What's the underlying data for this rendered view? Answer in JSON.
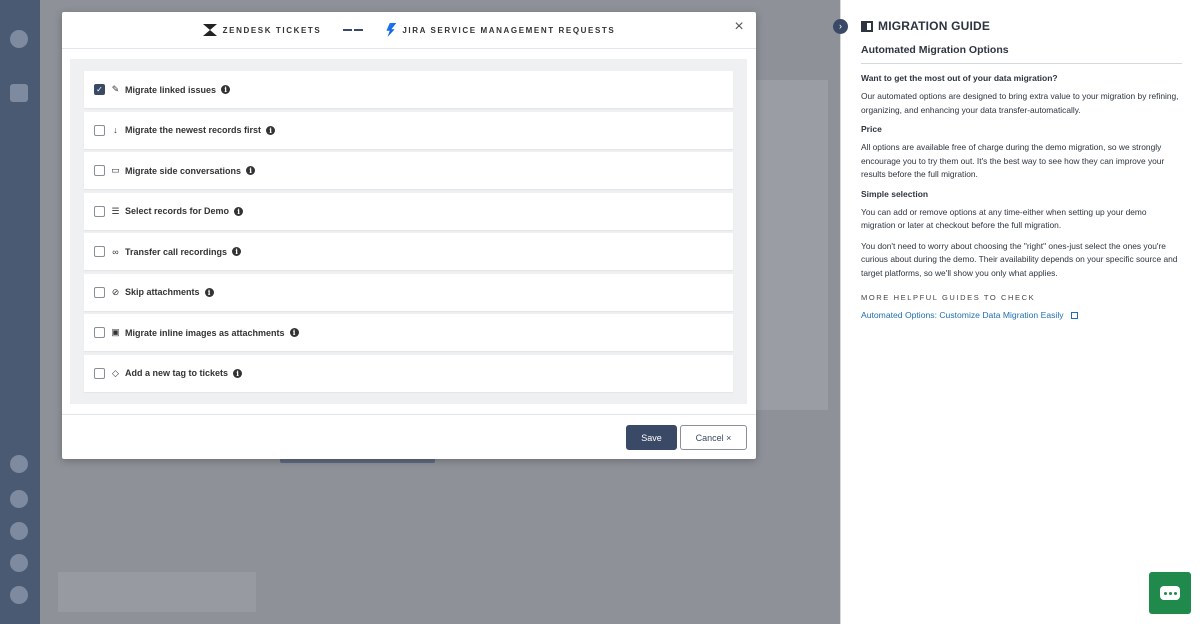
{
  "modal": {
    "source_platform": "ZENDESK TICKETS",
    "target_platform": "JIRA SERVICE MANAGEMENT REQUESTS",
    "close_symbol": "×",
    "options": [
      {
        "label": "Migrate linked issues",
        "checked": true,
        "icon": "✎"
      },
      {
        "label": "Migrate the newest records first",
        "checked": false,
        "icon": "↓"
      },
      {
        "label": "Migrate side conversations",
        "checked": false,
        "icon": "▭"
      },
      {
        "label": "Select records for Demo",
        "checked": false,
        "icon": "☰"
      },
      {
        "label": "Transfer call recordings",
        "checked": false,
        "icon": "∞"
      },
      {
        "label": "Skip attachments",
        "checked": false,
        "icon": "⊘"
      },
      {
        "label": "Migrate inline images as attachments",
        "checked": false,
        "icon": "▣"
      },
      {
        "label": "Add a new tag to tickets",
        "checked": false,
        "icon": "◇"
      }
    ],
    "save_label": "Save",
    "cancel_label": "Cancel ×"
  },
  "guide": {
    "title": "MIGRATION GUIDE",
    "subtitle": "Automated Migration Options",
    "heading_1": "Want to get the most out of your data migration?",
    "para_1": "Our automated options are designed to bring extra value to your migration by refining, organizing, and enhancing your data transfer-automatically.",
    "heading_2": "Price",
    "para_2": "All options are available free of charge during the demo migration, so we strongly encourage you to try them out. It's the best way to see how they can improve your results before the full migration.",
    "heading_3": "Simple selection",
    "para_3": "You can add or remove options at any time-either when setting up your demo migration or later at checkout before the full migration.",
    "para_4": "You don't need to worry about choosing the \"right\" ones-just select the ones you're curious about during the demo. Their availability depends on your specific source and target platforms, so we'll show you only what applies.",
    "more_label": "MORE HELPFUL GUIDES TO CHECK",
    "link_label": "Automated Options: Customize Data Migration Easily"
  },
  "colors": {
    "accent": "#3a4a66",
    "link": "#1f6fb2",
    "chat": "#1f8a4c"
  }
}
